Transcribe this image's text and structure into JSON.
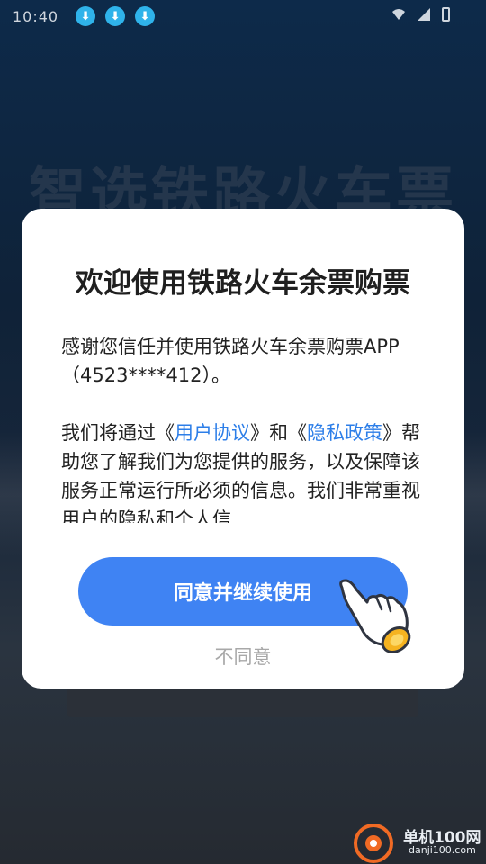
{
  "status_bar": {
    "time": "10:40",
    "download_icons": [
      "download-icon",
      "download-icon",
      "download-icon"
    ]
  },
  "background": {
    "app_title": "智选铁路火车票"
  },
  "dialog": {
    "title": "欢迎使用铁路火车余票购票",
    "paragraph1": "感谢您信任并使用铁路火车余票购票APP（4523****412）。",
    "p2_text1": "我们将通过《",
    "p2_link1": "用户协议",
    "p2_text2": "》和《",
    "p2_link2": "隐私政策",
    "p2_text3": "》帮助您了解我们为您提供的服务，以及保障该服务正常运行所必须的信息。我们非常重视用户的隐私和个人信",
    "agree_label": "同意并继续使用",
    "decline_label": "不同意"
  },
  "watermark": {
    "name": "单机100网",
    "url": "danji100.com"
  },
  "colors": {
    "primary": "#3f83f3",
    "link": "#2c7ee8"
  }
}
